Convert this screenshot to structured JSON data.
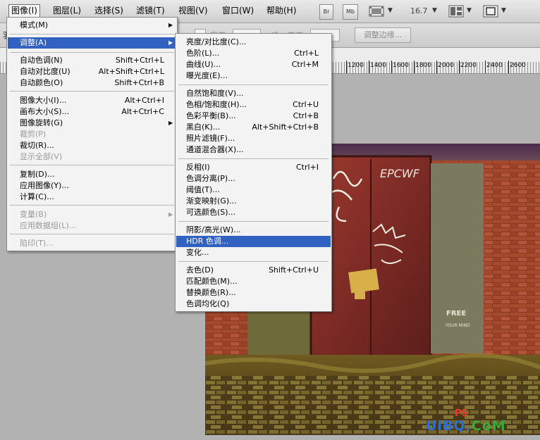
{
  "menubar": {
    "items": [
      {
        "label": "图像(I)",
        "active": true
      },
      {
        "label": "图层(L)"
      },
      {
        "label": "选择(S)"
      },
      {
        "label": "滤镜(T)"
      },
      {
        "label": "视图(V)"
      },
      {
        "label": "窗口(W)"
      },
      {
        "label": "帮助(H)"
      }
    ],
    "bridge_label": "Br",
    "minibridge_label": "Mb",
    "zoom": "16.7",
    "icons": [
      "film-strip-icon",
      "arrange-documents-icon",
      "screen-mode-icon"
    ]
  },
  "options_bar": {
    "left_fragment": "羽",
    "faded_width_label": "宽度",
    "faded_height_label": "高度",
    "refine_edge": "调整边缘..."
  },
  "ruler": {
    "labels": [
      "1200",
      "1400",
      "1600",
      "1800",
      "2000",
      "2200",
      "2400",
      "2600"
    ]
  },
  "image_menu": {
    "items": [
      {
        "label": "模式(M)",
        "submenu": true
      },
      {
        "label": "调整(A)",
        "submenu": true,
        "highlighted": true
      },
      {
        "label": "自动色调(N)",
        "shortcut": "Shift+Ctrl+L"
      },
      {
        "label": "自动对比度(U)",
        "shortcut": "Alt+Shift+Ctrl+L"
      },
      {
        "label": "自动颜色(O)",
        "shortcut": "Shift+Ctrl+B"
      },
      {
        "label": "图像大小(I)...",
        "shortcut": "Alt+Ctrl+I"
      },
      {
        "label": "画布大小(S)...",
        "shortcut": "Alt+Ctrl+C"
      },
      {
        "label": "图像旋转(G)",
        "submenu": true
      },
      {
        "label": "裁剪(P)",
        "disabled": true
      },
      {
        "label": "裁切(R)..."
      },
      {
        "label": "显示全部(V)",
        "disabled": true
      },
      {
        "label": "复制(D)..."
      },
      {
        "label": "应用图像(Y)..."
      },
      {
        "label": "计算(C)..."
      },
      {
        "label": "变量(B)",
        "submenu": true,
        "disabled": true
      },
      {
        "label": "应用数据组(L)...",
        "disabled": true
      },
      {
        "label": "陷印(T)...",
        "disabled": true
      }
    ]
  },
  "adjust_menu": {
    "items": [
      {
        "label": "亮度/对比度(C)..."
      },
      {
        "label": "色阶(L)...",
        "shortcut": "Ctrl+L"
      },
      {
        "label": "曲线(U)...",
        "shortcut": "Ctrl+M"
      },
      {
        "label": "曝光度(E)..."
      },
      {
        "label": "自然饱和度(V)..."
      },
      {
        "label": "色相/饱和度(H)...",
        "shortcut": "Ctrl+U"
      },
      {
        "label": "色彩平衡(B)...",
        "shortcut": "Ctrl+B"
      },
      {
        "label": "黑白(K)...",
        "shortcut": "Alt+Shift+Ctrl+B"
      },
      {
        "label": "照片滤镜(F)..."
      },
      {
        "label": "通道混合器(X)..."
      },
      {
        "label": "反相(I)",
        "shortcut": "Ctrl+I"
      },
      {
        "label": "色调分离(P)..."
      },
      {
        "label": "阈值(T)..."
      },
      {
        "label": "渐变映射(G)..."
      },
      {
        "label": "可选颜色(S)..."
      },
      {
        "label": "阴影/高光(W)..."
      },
      {
        "label": "HDR 色调...",
        "highlighted": true
      },
      {
        "label": "变化..."
      },
      {
        "label": "去色(D)",
        "shortcut": "Shift+Ctrl+U"
      },
      {
        "label": "匹配颜色(M)..."
      },
      {
        "label": "替换颜色(R)..."
      },
      {
        "label": "色调均化(Q)"
      }
    ]
  },
  "photo": {
    "graffiti_top": "EPCWF",
    "free_text": "FREE",
    "your_mind_text": "YOUR MIND"
  },
  "watermark": {
    "part1": "UiBQ.",
    "part2": "CoM",
    "ps_text": "PS"
  }
}
